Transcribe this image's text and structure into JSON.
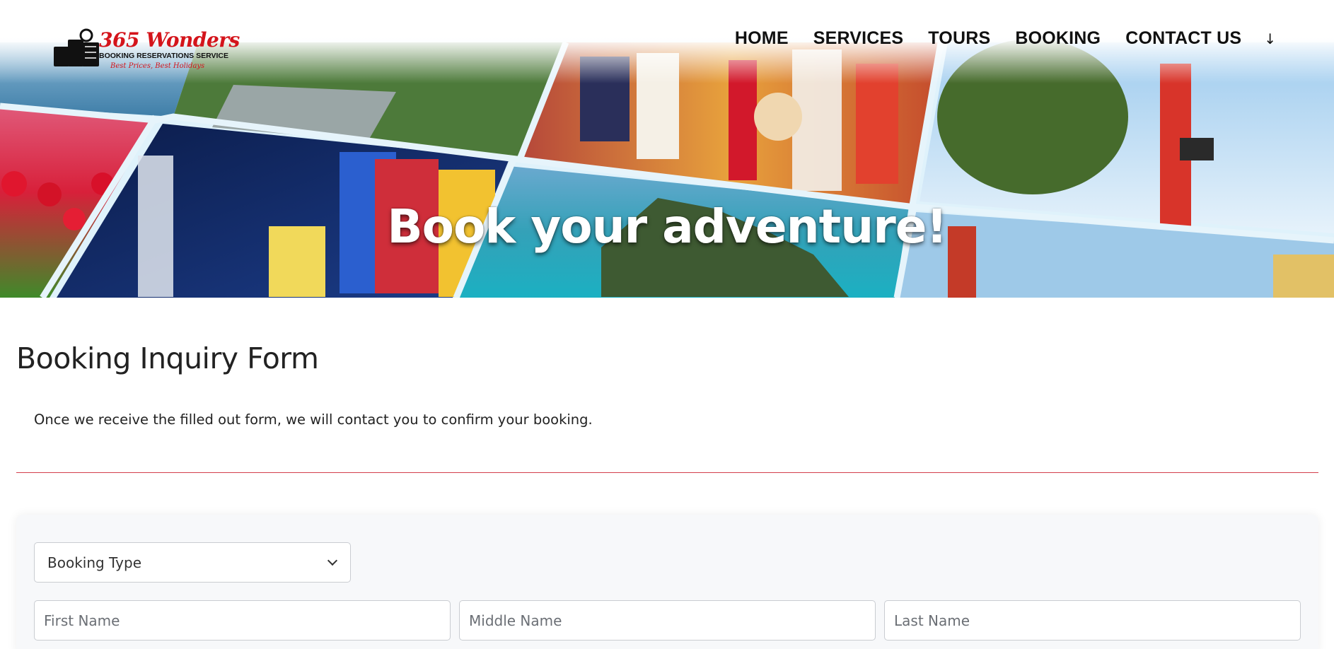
{
  "header": {
    "logo": {
      "brand": "365 Wonders",
      "subtitle": "BOOKING RESERVATIONS SERVICE",
      "tagline": "Best Prices, Best Holidays"
    },
    "nav": [
      {
        "label": "HOME"
      },
      {
        "label": "SERVICES"
      },
      {
        "label": "TOURS"
      },
      {
        "label": "BOOKING"
      },
      {
        "label": "CONTACT US"
      }
    ],
    "more_icon": "↓"
  },
  "hero": {
    "title": "Book your adventure!"
  },
  "main": {
    "title": "Booking Inquiry Form",
    "intro": "Once we receive the filled out form, we will contact you to confirm your booking."
  },
  "form": {
    "booking_type": {
      "selected": "Booking Type",
      "icon": "chevron-down-icon"
    },
    "first_name": {
      "placeholder": "First Name",
      "value": ""
    },
    "middle_name": {
      "placeholder": "Middle Name",
      "value": ""
    },
    "last_name": {
      "placeholder": "Last Name",
      "value": ""
    }
  },
  "colors": {
    "brand_red": "#d4141b",
    "divider": "#d33f4c",
    "card_bg": "#f7f8fa"
  }
}
